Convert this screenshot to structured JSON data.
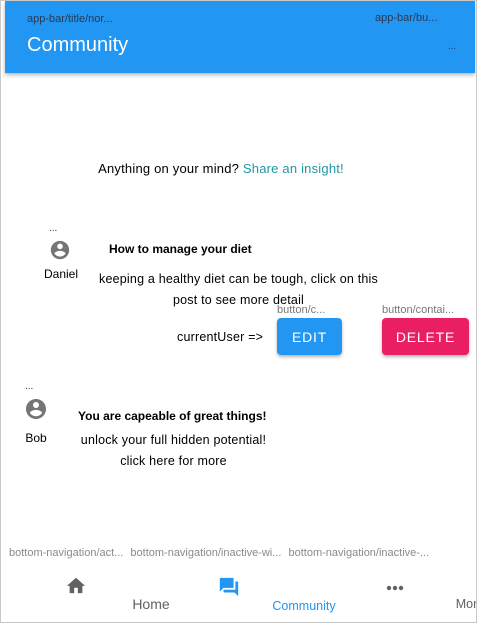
{
  "app_bar": {
    "overlay_title": "app-bar/title/nor...",
    "overlay_button": "app-bar/bu...",
    "overlay_dots": "...",
    "title": "Community"
  },
  "prompt": {
    "text": "Anything on your mind? ",
    "link": "Share an insight!"
  },
  "posts": [
    {
      "dots": "...",
      "author": "Daniel",
      "title": "How to manage your diet",
      "body_line1": "keeping a healthy diet can be tough, click on this",
      "body_line2": "post to see more detail",
      "owner_label": "currentUser =>",
      "edit_overlay": "button/c...",
      "edit_label": "EDIT",
      "delete_overlay": "button/contai...",
      "delete_label": "DELETE"
    },
    {
      "dots": "...",
      "author": "Bob",
      "title": "You are capeable of great things!",
      "body_line1": "unlock your full hidden potential!",
      "body_line2": "click here for more"
    }
  ],
  "bottom_nav": {
    "overlays": [
      "bottom-navigation/act...",
      "bottom-navigation/inactive-wi...",
      "bottom-navigation/inactive-..."
    ],
    "items": [
      {
        "label": "Home",
        "icon": "home-icon",
        "active": false
      },
      {
        "label": "Community",
        "icon": "forum-icon",
        "active": true
      },
      {
        "label": "More",
        "icon": "more-horiz-icon",
        "active": false
      }
    ]
  },
  "colors": {
    "primary": "#2196F3",
    "secondary": "#E91E63",
    "link": "#2196A6",
    "inactive": "#616161",
    "avatar": "#757575"
  }
}
